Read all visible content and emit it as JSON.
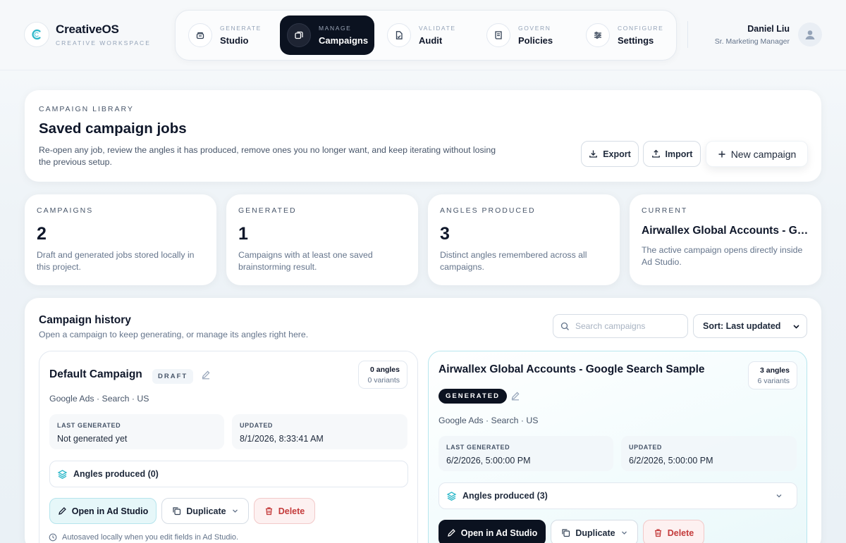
{
  "brand": {
    "name": "CreativeOS",
    "subtitle": "CREATIVE WORKSPACE",
    "logo_letter": "C"
  },
  "nav": [
    {
      "kicker": "GENERATE",
      "label": "Studio",
      "icon": "studio-icon",
      "active": false
    },
    {
      "kicker": "MANAGE",
      "label": "Campaigns",
      "icon": "campaigns-icon",
      "active": true
    },
    {
      "kicker": "VALIDATE",
      "label": "Audit",
      "icon": "audit-icon",
      "active": false
    },
    {
      "kicker": "GOVERN",
      "label": "Policies",
      "icon": "policies-icon",
      "active": false
    },
    {
      "kicker": "CONFIGURE",
      "label": "Settings",
      "icon": "settings-icon",
      "active": false
    }
  ],
  "user": {
    "name": "Daniel Liu",
    "role": "Sr. Marketing Manager"
  },
  "hero": {
    "eyebrow": "CAMPAIGN LIBRARY",
    "title": "Saved campaign jobs",
    "description": "Re-open any job, review the angles it has produced, remove ones you no longer want, and keep iterating without losing the previous setup.",
    "export_label": "Export",
    "import_label": "Import",
    "new_label": "New campaign"
  },
  "stats": [
    {
      "eyebrow": "CAMPAIGNS",
      "value": "2",
      "desc": "Draft and generated jobs stored locally in this project."
    },
    {
      "eyebrow": "GENERATED",
      "value": "1",
      "desc": "Campaigns with at least one saved brainstorming result."
    },
    {
      "eyebrow": "ANGLES PRODUCED",
      "value": "3",
      "desc": "Distinct angles remembered across all campaigns."
    },
    {
      "eyebrow": "CURRENT",
      "value": "Airwallex Global Accounts - Google Search Sample",
      "desc": "The active campaign opens directly inside Ad Studio."
    }
  ],
  "history": {
    "title": "Campaign history",
    "subtitle": "Open a campaign to keep generating, or manage its angles right here.",
    "search_placeholder": "Search campaigns",
    "sort_label": "Sort: Last updated"
  },
  "jobs": [
    {
      "title": "Default Campaign",
      "status": "DRAFT",
      "angles_count": "0 angles",
      "variants_count": "0 variants",
      "meta": "Google Ads · Search · US",
      "last_generated_key": "LAST GENERATED",
      "last_generated": "Not generated yet",
      "updated_key": "UPDATED",
      "updated": "8/1/2026, 8:33:41 AM",
      "angles_label": "Angles produced (0)",
      "open_label": "Open in Ad Studio",
      "duplicate_label": "Duplicate",
      "delete_label": "Delete",
      "autosave": "Autosaved locally when you edit fields in Ad Studio."
    },
    {
      "title": "Airwallex Global Accounts - Google Search Sample",
      "status": "GENERATED",
      "angles_count": "3 angles",
      "variants_count": "6 variants",
      "meta": "Google Ads · Search · US",
      "last_generated_key": "LAST GENERATED",
      "last_generated": "6/2/2026, 5:00:00 PM",
      "updated_key": "UPDATED",
      "updated": "6/2/2026, 5:00:00 PM",
      "angles_label": "Angles produced (3)",
      "open_label": "Open in Ad Studio",
      "duplicate_label": "Duplicate",
      "delete_label": "Delete"
    }
  ],
  "colors": {
    "accent": "#2bb7c9",
    "dark": "#0b1220",
    "danger": "#c43b3b"
  }
}
